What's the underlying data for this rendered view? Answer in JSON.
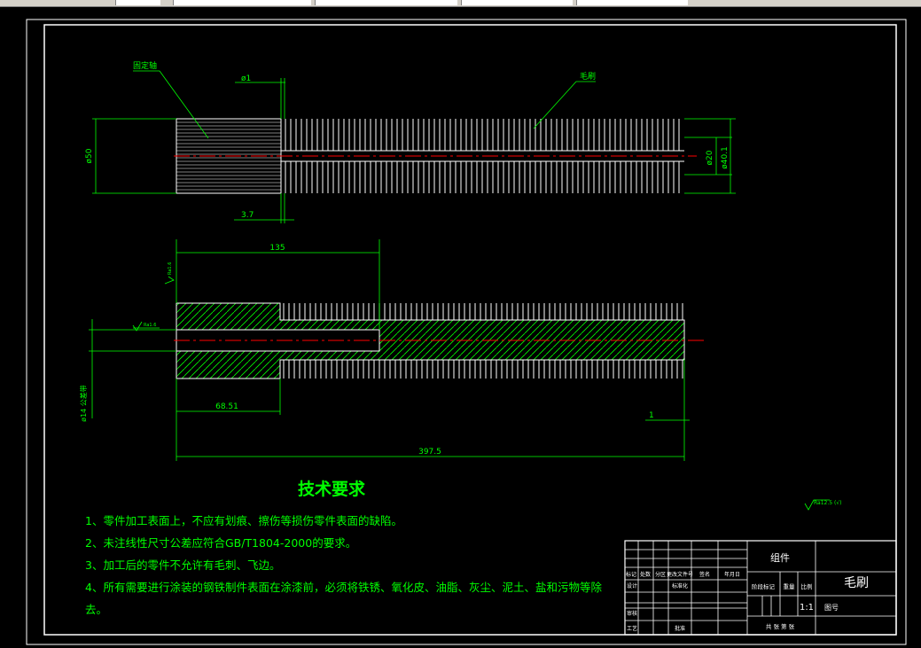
{
  "drawing": {
    "colors": {
      "background": "#000000",
      "frame": "#ffffff",
      "dimension": "#00ff00",
      "text": "#00ff00",
      "centerline": "#ff0000",
      "hatch": "#00ff00",
      "bristles": "#ffffff"
    },
    "labels": {
      "fixed_shaft": "固定轴",
      "bristles": "毛刷",
      "dim_d1": "ø1",
      "dim_d50": "ø50",
      "dim_d20": "ø20",
      "dim_d40": "ø40.1",
      "dim_3_7": "3.7",
      "dim_135": "135",
      "dim_68": "68.51",
      "dim_1": "1",
      "dim_total": "397.5",
      "dim_bore": "ø14 公差带",
      "rough_1": "Ra1.6",
      "rough_2": "Ra1.6",
      "rough_3": "Ra12.5 (√)"
    },
    "tech_req": {
      "title": "技术要求",
      "items": [
        "1、零件加工表面上，不应有划痕、擦伤等损伤零件表面的缺陷。",
        "2、未注线性尺寸公差应符合GB/T1804-2000的要求。",
        "3、加工后的零件不允许有毛刺、飞边。",
        "4、所有需要进行涂装的钢铁制件表面在涂漆前，必须将铁锈、氧化皮、油脂、灰尘、泥土、盐和污物等除",
        "去。"
      ]
    },
    "title_block": {
      "part_type": "组件",
      "part_name": "毛刷",
      "scale_label": "比例",
      "scale": "1:1",
      "weight_label": "重量",
      "stage_label": "阶段标记",
      "drawing_no_label": "图号",
      "sheet": "共 张 第 张",
      "rev_headers": [
        "标记",
        "处数",
        "分区",
        "更改文件号",
        "签名",
        "年月日"
      ],
      "design": "设计",
      "standard": "标准化",
      "check": "审核",
      "process": "工艺",
      "approve": "批准"
    }
  }
}
